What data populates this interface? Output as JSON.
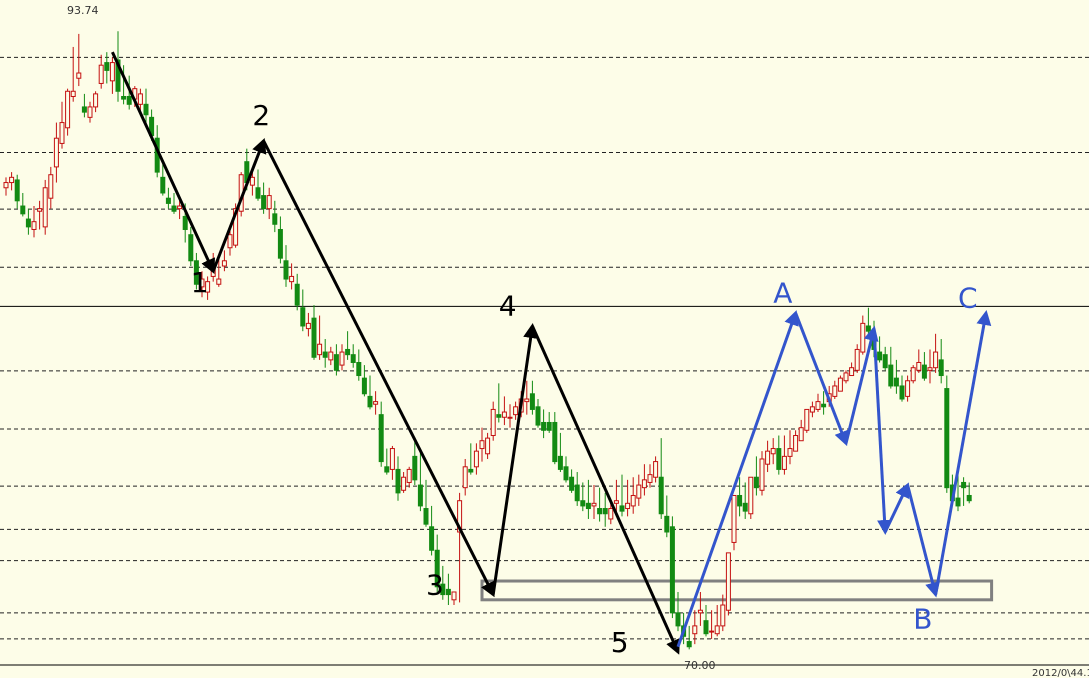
{
  "chart_data": {
    "type": "candlestick",
    "ylim": [
      69.5,
      95.0
    ],
    "price_labels": {
      "high": "93.74",
      "low": "70.00",
      "footer": "2012/0\\44.1"
    },
    "colors": {
      "up": "#c41010",
      "down": "#138a13",
      "wave_black": "#000000",
      "wave_blue": "#3355cc",
      "box": "#808080",
      "grid": "#222222",
      "background": "#fdfde8"
    },
    "gridlines": [
      92.8,
      89.15,
      86.98,
      84.75,
      80.78,
      78.55,
      76.36,
      74.7,
      73.5,
      71.5,
      70.5
    ],
    "resistance": 83.25,
    "support_box": {
      "top": 72.72,
      "bottom": 72.0,
      "from_index": 85,
      "to_index": 176
    },
    "candles": {
      "open": [
        87.8,
        88.0,
        88.1,
        87.1,
        86.6,
        86.2,
        86.9,
        86.3,
        87.4,
        88.6,
        89.5,
        90.1,
        91.3,
        92.0,
        90.9,
        90.5,
        90.9,
        91.8,
        92.6,
        91.9,
        92.7,
        91.3,
        91.3,
        91.2,
        91.0,
        91.0,
        90.5,
        89.7,
        88.2,
        87.4,
        87.1,
        87.0,
        86.7,
        86.0,
        85.0,
        84.0,
        83.8,
        84.4,
        84.1,
        84.8,
        85.5,
        85.6,
        86.9,
        88.8,
        87.9,
        87.8,
        87.5,
        87.0,
        86.8,
        86.2,
        85.0,
        84.2,
        84.1,
        83.2,
        82.4,
        82.8,
        81.4,
        81.5,
        81.2,
        81.4,
        81.0,
        81.6,
        81.4,
        81.1,
        80.5,
        79.8,
        79.5,
        79.1,
        77.1,
        77.0,
        77.0,
        76.2,
        76.5,
        77.5,
        76.4,
        75.5,
        74.8,
        73.9,
        72.6,
        72.4,
        72.0,
        74.6,
        76.3,
        77.0,
        77.1,
        77.8,
        77.6,
        78.3,
        79.1,
        79.0,
        79.0,
        79.1,
        79.2,
        79.6,
        79.9,
        79.4,
        78.8,
        78.8,
        78.8,
        77.5,
        77.1,
        76.7,
        76.4,
        75.8,
        75.7,
        75.6,
        75.5,
        75.5,
        75.1,
        75.7,
        75.6,
        75.5,
        75.6,
        75.9,
        76.3,
        76.5,
        76.7,
        76.7,
        75.2,
        74.8,
        71.5,
        71.0,
        70.4,
        70.7,
        71.5,
        71.2,
        70.8,
        70.7,
        71.0,
        71.6,
        74.2,
        76.0,
        75.7,
        75.3,
        76.7,
        76.2,
        77.2,
        77.6,
        77.8,
        77.0,
        77.5,
        77.7,
        78.1,
        78.5,
        79.2,
        79.3,
        79.5,
        79.6,
        79.8,
        80.0,
        80.4,
        80.6,
        80.8,
        81.5,
        82.5,
        82.1,
        81.5,
        81.4,
        81.0,
        80.5,
        80.2,
        79.8,
        80.4,
        80.8,
        81.0,
        80.8,
        80.9,
        81.2,
        80.1,
        76.4,
        75.9,
        76.5,
        76.0
      ],
      "high": [
        88.2,
        88.4,
        88.3,
        87.6,
        87.0,
        87.1,
        87.3,
        88.1,
        88.6,
        90.3,
        91.1,
        91.6,
        93.2,
        93.7,
        91.4,
        91.1,
        91.5,
        92.9,
        93.0,
        92.8,
        93.8,
        92.5,
        92.1,
        91.7,
        91.6,
        91.6,
        90.8,
        90.2,
        88.7,
        87.8,
        87.6,
        87.3,
        87.2,
        86.3,
        85.3,
        84.6,
        84.4,
        85.3,
        85.1,
        85.4,
        86.2,
        87.2,
        88.4,
        89.3,
        88.4,
        88.5,
        88.0,
        87.8,
        87.3,
        86.7,
        85.6,
        84.9,
        84.5,
        83.9,
        83.0,
        83.3,
        82.9,
        82.0,
        81.7,
        81.8,
        81.8,
        82.3,
        81.8,
        81.6,
        81.0,
        80.6,
        80.0,
        79.6,
        77.8,
        77.9,
        77.5,
        76.9,
        77.1,
        78.1,
        77.8,
        76.6,
        75.6,
        74.5,
        73.3,
        73.0,
        72.3,
        76.1,
        77.4,
        78.0,
        78.0,
        78.6,
        78.4,
        79.6,
        80.3,
        79.8,
        79.5,
        79.6,
        80.0,
        80.4,
        80.4,
        79.7,
        79.3,
        79.2,
        79.2,
        78.4,
        77.5,
        77.0,
        76.9,
        76.5,
        76.6,
        76.4,
        76.3,
        76.1,
        75.8,
        76.6,
        76.8,
        76.6,
        76.7,
        76.8,
        77.2,
        77.2,
        77.5,
        78.2,
        76.0,
        75.2,
        72.3,
        71.5,
        71.0,
        71.6,
        72.3,
        71.8,
        71.6,
        71.8,
        72.2,
        73.4,
        76.0,
        76.7,
        76.5,
        76.5,
        77.5,
        77.7,
        78.1,
        78.2,
        78.3,
        78.3,
        78.5,
        78.5,
        78.9,
        79.1,
        79.6,
        79.9,
        80.0,
        80.2,
        80.4,
        80.6,
        80.8,
        81.1,
        81.8,
        82.9,
        83.2,
        82.7,
        82.1,
        81.7,
        81.7,
        81.2,
        80.6,
        80.6,
        81.0,
        81.6,
        81.5,
        81.6,
        82.2,
        82.0,
        80.6,
        76.8,
        76.8,
        76.7,
        76.5
      ],
      "low": [
        87.5,
        87.7,
        87.0,
        86.7,
        86.0,
        85.9,
        86.2,
        86.0,
        87.0,
        88.0,
        89.3,
        89.8,
        91.1,
        91.7,
        90.5,
        90.3,
        90.7,
        91.6,
        91.8,
        91.4,
        91.1,
        91.0,
        90.8,
        90.9,
        90.7,
        90.1,
        89.6,
        88.2,
        87.5,
        87.0,
        86.8,
        86.6,
        85.7,
        84.8,
        83.9,
        83.6,
        83.5,
        84.2,
        84.0,
        84.6,
        85.2,
        85.5,
        86.7,
        87.7,
        87.5,
        87.3,
        86.8,
        86.6,
        86.1,
        84.9,
        84.0,
        83.9,
        83.1,
        82.3,
        82.1,
        81.2,
        81.2,
        80.9,
        81.0,
        80.6,
        80.8,
        81.2,
        80.9,
        80.4,
        79.8,
        79.3,
        79.1,
        77.1,
        76.8,
        76.6,
        75.8,
        76.1,
        76.3,
        76.4,
        75.4,
        74.8,
        73.7,
        72.3,
        72.0,
        71.8,
        71.8,
        71.9,
        76.0,
        76.8,
        76.8,
        77.3,
        77.4,
        78.1,
        78.8,
        78.7,
        78.6,
        78.9,
        79.0,
        79.1,
        79.1,
        78.6,
        78.2,
        78.4,
        77.2,
        76.9,
        76.5,
        76.1,
        75.6,
        75.4,
        75.1,
        75.1,
        75.0,
        74.8,
        74.9,
        75.2,
        75.2,
        75.2,
        75.3,
        75.6,
        76.0,
        76.3,
        76.5,
        75.1,
        74.4,
        71.3,
        70.8,
        70.3,
        70.1,
        70.3,
        71.0,
        70.6,
        70.5,
        70.6,
        70.8,
        71.4,
        73.9,
        75.2,
        75.1,
        75.1,
        76.0,
        76.0,
        76.9,
        77.2,
        76.8,
        76.8,
        77.2,
        77.7,
        78.1,
        78.4,
        79.0,
        79.2,
        79.1,
        79.4,
        79.7,
        80.0,
        80.3,
        80.6,
        80.7,
        81.4,
        82.1,
        81.3,
        81.1,
        80.8,
        80.1,
        79.9,
        79.6,
        79.6,
        80.3,
        80.7,
        80.4,
        80.3,
        80.7,
        80.3,
        76.1,
        75.7,
        75.4,
        75.6,
        75.7
      ],
      "close": [
        88.0,
        88.2,
        87.3,
        86.8,
        86.3,
        86.5,
        87.0,
        87.8,
        88.3,
        89.7,
        90.3,
        91.5,
        91.5,
        92.2,
        90.7,
        90.9,
        91.4,
        92.5,
        92.3,
        92.6,
        91.5,
        91.2,
        91.0,
        91.6,
        91.4,
        90.6,
        89.8,
        88.4,
        87.6,
        87.2,
        86.9,
        87.1,
        86.2,
        85.0,
        84.1,
        84.3,
        84.2,
        84.7,
        84.3,
        85.0,
        86.0,
        87.0,
        88.3,
        88.0,
        88.2,
        87.4,
        87.0,
        87.5,
        86.4,
        85.1,
        84.3,
        84.4,
        83.3,
        82.5,
        82.6,
        81.3,
        81.8,
        81.3,
        81.5,
        80.8,
        81.5,
        81.4,
        81.1,
        80.6,
        79.9,
        79.4,
        79.6,
        77.3,
        76.9,
        77.8,
        76.1,
        76.7,
        77.0,
        76.6,
        75.6,
        74.9,
        73.9,
        72.5,
        72.2,
        72.2,
        72.3,
        75.8,
        77.1,
        76.9,
        77.7,
        78.1,
        78.2,
        79.3,
        79.0,
        79.2,
        79.0,
        79.4,
        79.7,
        79.7,
        79.3,
        78.7,
        78.5,
        78.5,
        77.3,
        77.0,
        76.6,
        76.2,
        75.8,
        75.6,
        75.5,
        75.7,
        75.3,
        75.3,
        75.5,
        75.8,
        75.4,
        75.7,
        76.0,
        76.4,
        76.6,
        76.8,
        77.3,
        75.3,
        74.6,
        71.5,
        71.0,
        70.6,
        70.2,
        71.0,
        71.6,
        70.7,
        70.8,
        71.0,
        71.8,
        73.8,
        76.0,
        75.6,
        75.4,
        76.7,
        76.3,
        77.4,
        77.7,
        77.8,
        77.0,
        77.5,
        77.8,
        78.3,
        78.6,
        79.3,
        79.4,
        79.6,
        79.4,
        79.9,
        80.2,
        80.5,
        80.7,
        80.9,
        81.6,
        82.6,
        82.3,
        81.6,
        81.2,
        80.9,
        80.2,
        80.2,
        79.7,
        80.4,
        80.9,
        81.1,
        80.5,
        80.9,
        81.5,
        80.6,
        76.3,
        75.8,
        75.6,
        76.3,
        75.8
      ]
    },
    "waves": [
      {
        "label": "1",
        "color": "black",
        "from": [
          19,
          93.0
        ],
        "to": [
          37,
          84.6
        ]
      },
      {
        "label": "2",
        "color": "black",
        "from": [
          37,
          84.6
        ],
        "to": [
          46,
          89.6
        ]
      },
      {
        "label": "3",
        "color": "black",
        "from": [
          46,
          89.6
        ],
        "to": [
          87,
          72.2
        ]
      },
      {
        "label": "4",
        "color": "black",
        "from": [
          87,
          72.2
        ],
        "to": [
          94,
          82.5
        ]
      },
      {
        "label": "5",
        "color": "black",
        "from": [
          94,
          82.5
        ],
        "to": [
          120,
          70.0
        ]
      },
      {
        "label": "A",
        "color": "blue",
        "from": [
          120,
          70.2
        ],
        "to": [
          141,
          83.0
        ]
      },
      {
        "label": "",
        "color": "blue",
        "from": [
          141,
          83.0
        ],
        "to": [
          150,
          78.0
        ]
      },
      {
        "label": "",
        "color": "blue",
        "from": [
          150,
          78.0
        ],
        "to": [
          155,
          82.4
        ]
      },
      {
        "label": "",
        "color": "blue",
        "from": [
          155,
          82.4
        ],
        "to": [
          157,
          74.6
        ]
      },
      {
        "label": "",
        "color": "blue",
        "from": [
          157,
          74.6
        ],
        "to": [
          161,
          76.4
        ]
      },
      {
        "label": "B",
        "color": "blue",
        "from": [
          161,
          76.4
        ],
        "to": [
          166,
          72.2
        ]
      },
      {
        "label": "C",
        "color": "blue",
        "from": [
          166,
          72.2
        ],
        "to": [
          175,
          83.0
        ]
      }
    ],
    "wave_labels": [
      {
        "text": "1",
        "x": 33,
        "y": 83.8
      },
      {
        "text": "2",
        "x": 44,
        "y": 90.2
      },
      {
        "text": "3",
        "x": 75,
        "y": 72.2
      },
      {
        "text": "4",
        "x": 88,
        "y": 82.9
      },
      {
        "text": "5",
        "x": 108,
        "y": 70.0
      },
      {
        "text": "A",
        "x": 137,
        "y": 83.4
      },
      {
        "text": "B",
        "x": 162,
        "y": 70.9
      },
      {
        "text": "C",
        "x": 170,
        "y": 83.2
      }
    ]
  }
}
